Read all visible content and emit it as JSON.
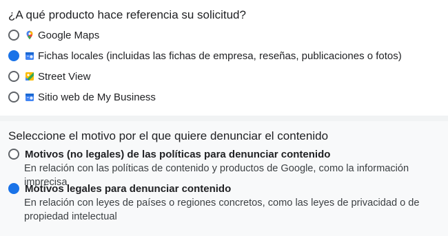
{
  "product_question": "¿A qué producto hace referencia su solicitud?",
  "products": [
    {
      "label": "Google Maps",
      "icon": "google-maps-pin-icon",
      "selected": false
    },
    {
      "label": "Fichas locales (incluidas las fichas de empresa, reseñas, publicaciones o fotos)",
      "icon": "business-profile-icon",
      "selected": true
    },
    {
      "label": "Street View",
      "icon": "street-view-icon",
      "selected": false
    },
    {
      "label": "Sitio web de My Business",
      "icon": "business-profile-icon",
      "selected": false
    }
  ],
  "reason_question": "Seleccione el motivo por el que quiere denunciar el contenido",
  "reasons": [
    {
      "title": "Motivos (no legales) de las políticas para denunciar contenido",
      "description": "En relación con las políticas de contenido y productos de Google, como la información imprecisa",
      "selected": false
    },
    {
      "title": "Motivos legales para denunciar contenido",
      "description": "En relación con leyes de países o regiones concretos, como las leyes de privacidad o de propiedad intelectual",
      "selected": true
    }
  ],
  "colors": {
    "accent": "#1a73e8",
    "radio_border": "#5f6368",
    "section_bg": "#f8f9fa"
  }
}
